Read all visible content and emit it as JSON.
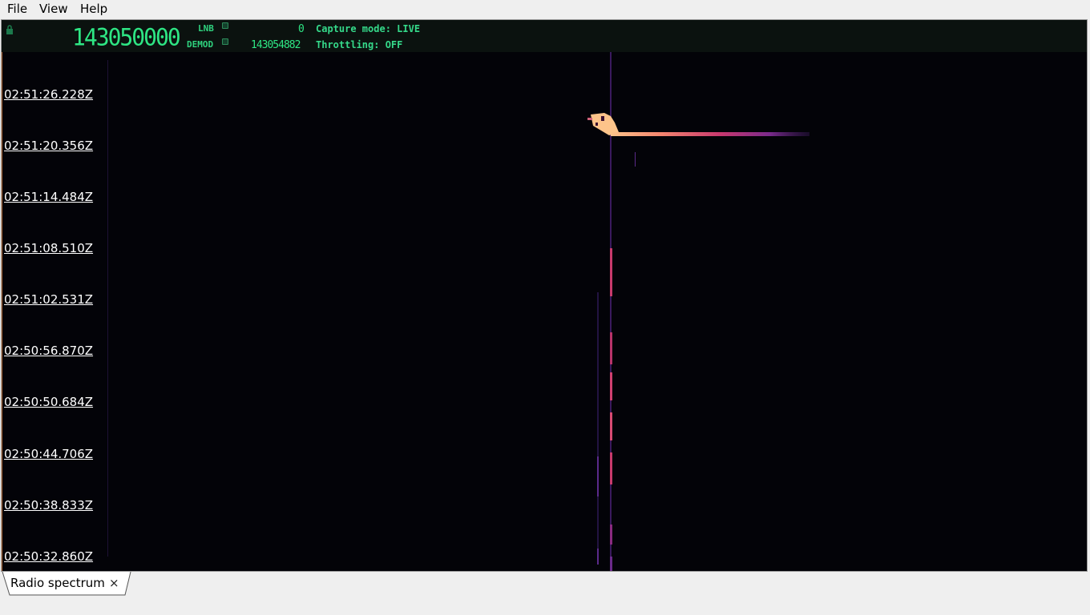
{
  "menu": {
    "file": "File",
    "view": "View",
    "help": "Help"
  },
  "header": {
    "main_frequency": "143050000",
    "lnb_label": "LNB",
    "lnb_value": "0",
    "demod_label": "DEMOD",
    "demod_value": "143054882",
    "capture_mode": "Capture mode: LIVE",
    "throttling": "Throttling: OFF"
  },
  "waterfall": {
    "timestamps": [
      "02:51:26.228Z",
      "02:51:20.356Z",
      "02:51:14.484Z",
      "02:51:08.510Z",
      "02:51:02.531Z",
      "02:50:56.870Z",
      "02:50:50.684Z",
      "02:50:44.706Z",
      "02:50:38.833Z",
      "02:50:32.860Z"
    ],
    "colors": {
      "background": "#030308",
      "hot": "#fdc48a",
      "mid": "#e8507a",
      "cool": "#6a2c9a"
    }
  },
  "tabs": [
    {
      "label": "Radio spectrum",
      "close": "×"
    }
  ]
}
